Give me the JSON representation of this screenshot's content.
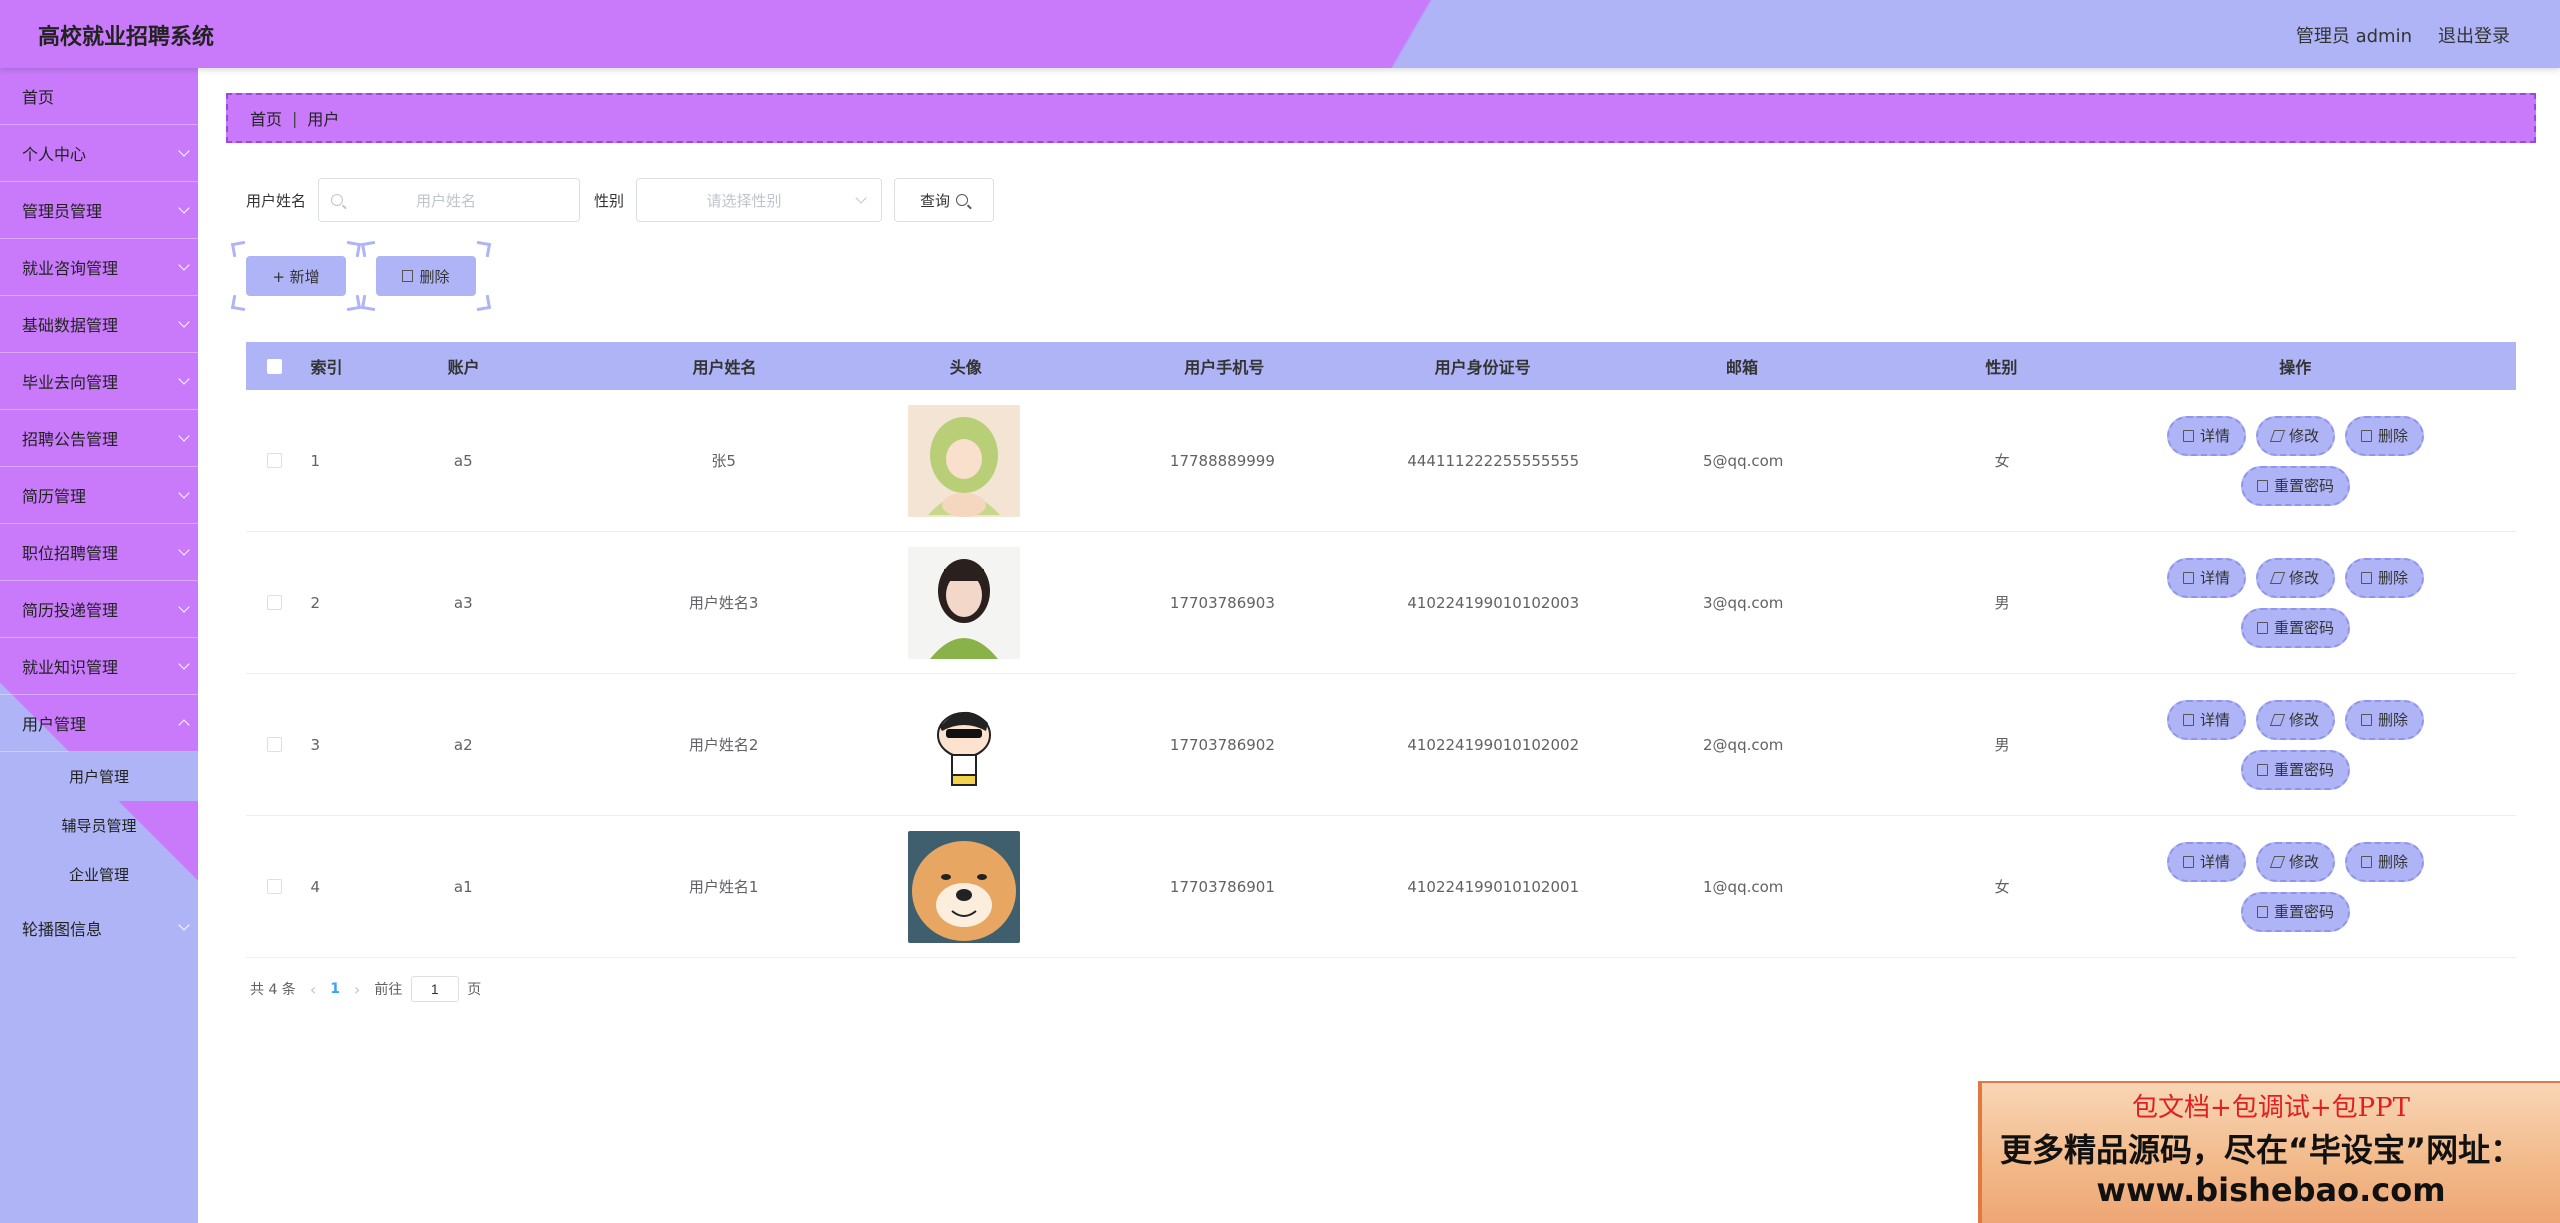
{
  "header": {
    "title": "高校就业招聘系统",
    "admin_label": "管理员 admin",
    "logout": "退出登录"
  },
  "sidebar": {
    "items": [
      {
        "label": "首页"
      },
      {
        "label": "个人中心"
      },
      {
        "label": "管理员管理"
      },
      {
        "label": "就业咨询管理"
      },
      {
        "label": "基础数据管理"
      },
      {
        "label": "毕业去向管理"
      },
      {
        "label": "招聘公告管理"
      },
      {
        "label": "简历管理"
      },
      {
        "label": "职位招聘管理"
      },
      {
        "label": "简历投递管理"
      },
      {
        "label": "就业知识管理"
      },
      {
        "label": "用户管理"
      }
    ],
    "sub_items": [
      {
        "label": "用户管理"
      },
      {
        "label": "辅导员管理"
      },
      {
        "label": "企业管理"
      }
    ],
    "last_item": {
      "label": "轮播图信息"
    }
  },
  "breadcrumb": {
    "home": "首页",
    "sep": "|",
    "current": "用户"
  },
  "search": {
    "name_label": "用户姓名",
    "name_placeholder": "用户姓名",
    "sex_label": "性别",
    "sex_placeholder": "请选择性别",
    "query_label": "查询"
  },
  "actions": {
    "add": "+ 新增",
    "delete": "删除"
  },
  "table": {
    "headers": [
      "索引",
      "账户",
      "用户姓名",
      "头像",
      "用户手机号",
      "用户身份证号",
      "邮箱",
      "性别",
      "操作"
    ],
    "rows": [
      {
        "idx": "1",
        "account": "a5",
        "name": "张5",
        "avatar": "anime-girl",
        "phone": "17788889999",
        "id": "444111222255555555",
        "email": "5@qq.com",
        "sex": "女"
      },
      {
        "idx": "2",
        "account": "a3",
        "name": "用户姓名3",
        "avatar": "girl-photo",
        "phone": "17703786903",
        "id": "410224199010102003",
        "email": "3@qq.com",
        "sex": "男"
      },
      {
        "idx": "3",
        "account": "a2",
        "name": "用户姓名2",
        "avatar": "cartoon-boy",
        "phone": "17703786902",
        "id": "410224199010102002",
        "email": "2@qq.com",
        "sex": "男"
      },
      {
        "idx": "4",
        "account": "a1",
        "name": "用户姓名1",
        "avatar": "shiba-dog",
        "phone": "17703786901",
        "id": "410224199010102001",
        "email": "1@qq.com",
        "sex": "女"
      }
    ],
    "ops": {
      "detail": "详情",
      "edit": "修改",
      "delete": "删除",
      "reset": "重置密码"
    }
  },
  "pager": {
    "total": "共 4 条",
    "current": "1",
    "goto_prefix": "前往",
    "goto_value": "1",
    "goto_suffix": "页"
  },
  "ad": {
    "line1": "包文档+包调试+包PPT",
    "line2": "更多精品源码，尽在“毕设宝”网址：",
    "line3": "www.bishebao.com"
  },
  "colors": {
    "purple": "#c87afa",
    "lavender": "#aeb4f5"
  }
}
